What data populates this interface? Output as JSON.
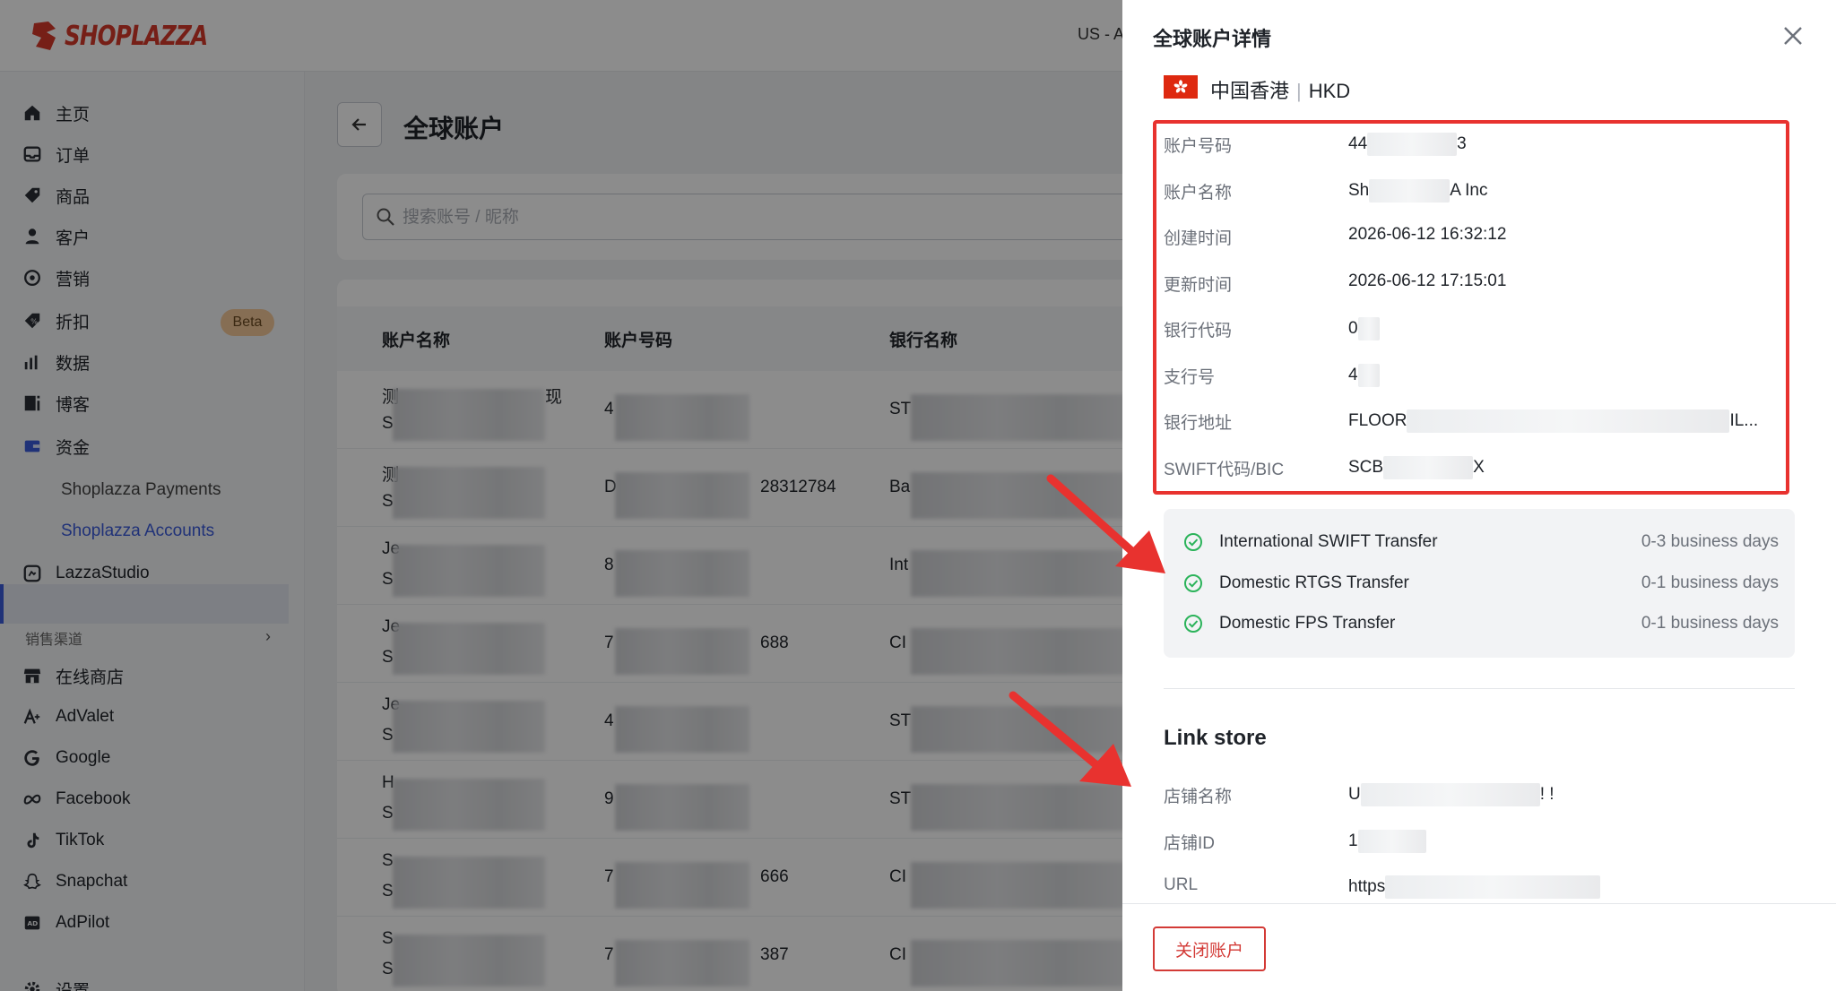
{
  "app": {
    "brand": "SHOPLAZZA",
    "region": "US - A"
  },
  "sidebar": {
    "items": [
      {
        "label": "主页",
        "icon": "home-icon"
      },
      {
        "label": "订单",
        "icon": "inbox-icon"
      },
      {
        "label": "商品",
        "icon": "tag-icon"
      },
      {
        "label": "客户",
        "icon": "person-icon"
      },
      {
        "label": "营销",
        "icon": "target-icon"
      },
      {
        "label": "折扣",
        "icon": "discount-icon"
      },
      {
        "label": "数据",
        "icon": "bar-chart-icon"
      },
      {
        "label": "博客",
        "icon": "blog-icon"
      },
      {
        "label": "资金",
        "icon": "wallet-icon"
      }
    ],
    "beta_label": "Beta",
    "funds_sub": [
      "Shoplazza Payments",
      "Shoplazza Accounts"
    ],
    "lazza_studio": "LazzaStudio",
    "sales_channel_title": "销售渠道",
    "channels": [
      {
        "label": "在线商店",
        "icon": "store-icon"
      },
      {
        "label": "AdValet",
        "icon": "advalet-icon"
      },
      {
        "label": "Google",
        "icon": "google-icon"
      },
      {
        "label": "Facebook",
        "icon": "meta-icon"
      },
      {
        "label": "TikTok",
        "icon": "tiktok-icon"
      },
      {
        "label": "Snapchat",
        "icon": "snapchat-icon"
      },
      {
        "label": "AdPilot",
        "icon": "adpilot-icon"
      }
    ],
    "settings": "设置"
  },
  "main": {
    "title": "全球账户",
    "search_placeholder": "搜索账号 / 昵称",
    "columns": [
      "账户名称",
      "账户号码",
      "银行名称"
    ],
    "rows": [
      {
        "name_top": "测",
        "name_suffix": "现",
        "name_bottom": "S",
        "number": "4",
        "number_tail": "",
        "bank": "ST"
      },
      {
        "name_top": "测",
        "name_suffix": "",
        "name_bottom": "S",
        "number": "D",
        "number_tail": "28312784",
        "bank": "Ba"
      },
      {
        "name_top": "Je",
        "name_suffix": "",
        "name_bottom": "S",
        "number": "8",
        "number_tail": "",
        "bank": "Int"
      },
      {
        "name_top": "Je",
        "name_suffix": "",
        "name_bottom": "S",
        "number": "7",
        "number_tail": "688",
        "bank": "CI"
      },
      {
        "name_top": "Je",
        "name_suffix": "",
        "name_bottom": "S",
        "number": "4",
        "number_tail": "",
        "bank": "ST"
      },
      {
        "name_top": "H",
        "name_suffix": "",
        "name_bottom": "S",
        "number": "9",
        "number_tail": "",
        "bank": "ST"
      },
      {
        "name_top": "S",
        "name_suffix": "",
        "name_bottom": "S",
        "number": "7",
        "number_tail": "666",
        "bank": "CI"
      },
      {
        "name_top": "S",
        "name_suffix": "",
        "name_bottom": "S",
        "number": "7",
        "number_tail": "387",
        "bank": "CI"
      }
    ]
  },
  "drawer": {
    "title": "全球账户详情",
    "region": "中国香港",
    "currency": "HKD",
    "details": [
      {
        "label": "账户号码",
        "value_start": "44",
        "value_end": "3"
      },
      {
        "label": "账户名称",
        "value_start": "Sh",
        "value_end": "A Inc"
      },
      {
        "label": "创建时间",
        "value_start": "2026-06-12 16:32:12",
        "value_end": ""
      },
      {
        "label": "更新时间",
        "value_start": "2026-06-12 17:15:01",
        "value_end": ""
      },
      {
        "label": "银行代码",
        "value_start": "0",
        "value_end": ""
      },
      {
        "label": "支行号",
        "value_start": "4",
        "value_end": ""
      },
      {
        "label": "银行地址",
        "value_start": "FLOOR",
        "value_end": "IL..."
      },
      {
        "label": "SWIFT代码/BIC",
        "value_start": "SCB",
        "value_end": "X"
      }
    ],
    "transfers": [
      {
        "name": "International SWIFT Transfer",
        "days": "0-3 business days"
      },
      {
        "name": "Domestic RTGS Transfer",
        "days": "0-1 business days"
      },
      {
        "name": "Domestic FPS Transfer",
        "days": "0-1 business days"
      }
    ],
    "link_store_title": "Link store",
    "store": [
      {
        "label": "店铺名称",
        "value_start": "U",
        "value_end": "! !"
      },
      {
        "label": "店铺ID",
        "value_start": "1",
        "value_end": ""
      },
      {
        "label": "URL",
        "value_start": "https",
        "value_end": ""
      }
    ],
    "close_account": "关闭账户"
  },
  "colors": {
    "brand": "#d83a2b",
    "highlight": "#e8322f",
    "success": "#2bb35a",
    "active_nav": "#3b5bdb"
  }
}
